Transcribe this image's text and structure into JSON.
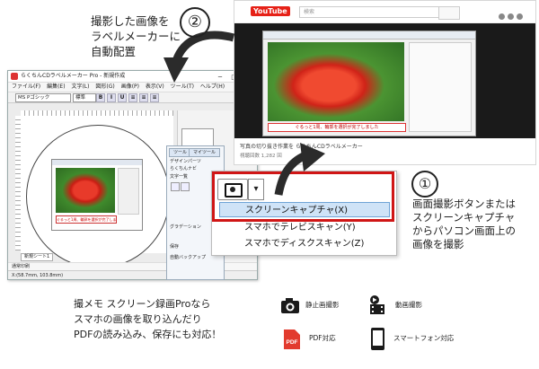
{
  "annotations": {
    "step2_number": "②",
    "step2_lines": [
      "撮影した画像を",
      "ラベルメーカーに",
      "自動配置"
    ],
    "step1_number": "①",
    "step1_lines": [
      "画面撮影ボタンまたは",
      "スクリーンキャプチャ",
      "からパソコン画面上の",
      "画像を撮影"
    ],
    "bottom_lines": [
      "撮メモ スクリーン録画Proなら",
      "スマホの画像を取り込んだり",
      "PDFの読み込み、保存にも対応！"
    ]
  },
  "features": [
    {
      "icon": "camera-icon",
      "label": "静止画撮影"
    },
    {
      "icon": "video-icon",
      "label": "動画撮影"
    },
    {
      "icon": "pdf-icon",
      "label": "PDF対応"
    },
    {
      "icon": "smartphone-icon",
      "label": "スマートフォン対応"
    }
  ],
  "capture_menu": {
    "items": [
      "スクリーンキャプチャ(X)",
      "スマホでテレビスキャン(Y)",
      "スマホでディスクスキャン(Z)"
    ],
    "selected_index": 0
  },
  "app_window": {
    "title": "らくちんCDラベルメーカー Pro - 新規作成",
    "menu": [
      "ファイル(F)",
      "編集(E)",
      "文字(L)",
      "図形(G)",
      "画像(P)",
      "表示(V)",
      "ツール(T)",
      "ヘルプ(H)"
    ],
    "font_name": "MS Pゴシック",
    "font_size": "標準",
    "tabs": [
      "ツール",
      "デザイン"
    ],
    "panel_items": [
      "らくちんナビ",
      "テンプレート",
      "文字一覧",
      "オブジェクト",
      "ツール",
      "グラデーション",
      "画像",
      "ペイント",
      "保存",
      "自動保存"
    ],
    "sheet_tab": "新規シート1",
    "options_bar": "通常印刷",
    "status": "X:(58.7mm, 103.8mm)",
    "photo_caption": "ぐるっと1周、輪郭を選択が完了しました"
  },
  "side_panel": {
    "tabs": [
      "ツール",
      "マイツール"
    ],
    "rows": [
      "デザインパーツ",
      "らくちんナビ",
      "文字一覧",
      "グラデーション",
      "保存",
      "自動バックアップ"
    ]
  },
  "video_page": {
    "logo": "YouTube",
    "search_placeholder": "検索",
    "video_title": "写真の切り抜き作業を らくちんCDラベルメーカー",
    "views": "視聴回数 1,282 回",
    "caption": "ぐるっと1周、輪郭を選択が完了しました"
  },
  "colors": {
    "highlight_red": "#d01616",
    "menu_selected": "#cfe3f7",
    "youtube_red": "#e62117"
  }
}
